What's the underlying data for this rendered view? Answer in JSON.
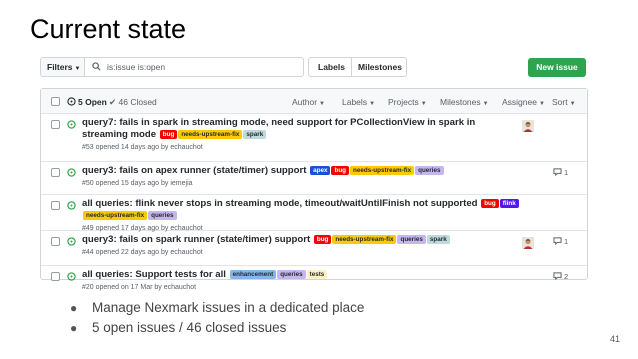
{
  "slide": {
    "title": "Current state",
    "bullets": [
      "Manage Nexmark issues in a dedicated place",
      "5 open issues / 46 closed issues"
    ],
    "page_number": "41"
  },
  "toolbar": {
    "filters_label": "Filters",
    "search_value": "is:issue is:open",
    "labels_label": "Labels",
    "milestones_label": "Milestones",
    "new_issue_label": "New issue"
  },
  "list_header": {
    "open_count": "5 Open",
    "closed_count": "46 Closed",
    "menus": [
      "Author",
      "Labels",
      "Projects",
      "Milestones",
      "Assignee",
      "Sort"
    ]
  },
  "label_colors": {
    "bug": {
      "bg": "#ee0701",
      "fg": "#ffffff"
    },
    "needs-upstream-fix": {
      "bg": "#fbca04",
      "fg": "#24292e"
    },
    "spark": {
      "bg": "#bfdadc",
      "fg": "#24292e"
    },
    "apex": {
      "bg": "#1d4ed8",
      "fg": "#ffffff"
    },
    "queries": {
      "bg": "#c5b6f1",
      "fg": "#24292e"
    },
    "flink": {
      "bg": "#5319e7",
      "fg": "#ffffff"
    },
    "enhancement": {
      "bg": "#84b6eb",
      "fg": "#24292e"
    },
    "tests": {
      "bg": "#fef2c0",
      "fg": "#24292e"
    }
  },
  "issues": [
    {
      "title": "query7: fails in spark in streaming mode, need support for PCollectionView in spark in streaming mode",
      "labels": [
        "bug",
        "needs-upstream-fix",
        "spark"
      ],
      "meta": "#53 opened 14 days ago by echauchot",
      "has_avatar": true,
      "comments": ""
    },
    {
      "title": "query3: fails on apex runner (state/timer) support",
      "labels": [
        "apex",
        "bug",
        "needs-upstream-fix",
        "queries"
      ],
      "meta": "#50 opened 15 days ago by iemejia",
      "has_avatar": false,
      "comments": "1"
    },
    {
      "title": "all queries: flink never stops in streaming mode, timeout/waitUntilFinish not supported",
      "labels": [
        "bug",
        "flink",
        "needs-upstream-fix",
        "queries"
      ],
      "meta": "#49 opened 17 days ago by echauchot",
      "has_avatar": false,
      "comments": ""
    },
    {
      "title": "query3: fails on spark runner (state/timer) support",
      "labels": [
        "bug",
        "needs-upstream-fix",
        "queries",
        "spark"
      ],
      "meta": "#44 opened 22 days ago by echauchot",
      "has_avatar": true,
      "comments": "1"
    },
    {
      "title": "all queries: Support tests for all",
      "labels": [
        "enhancement",
        "queries",
        "tests"
      ],
      "meta": "#20 opened on 17 Mar by echauchot",
      "has_avatar": false,
      "comments": "2"
    }
  ]
}
